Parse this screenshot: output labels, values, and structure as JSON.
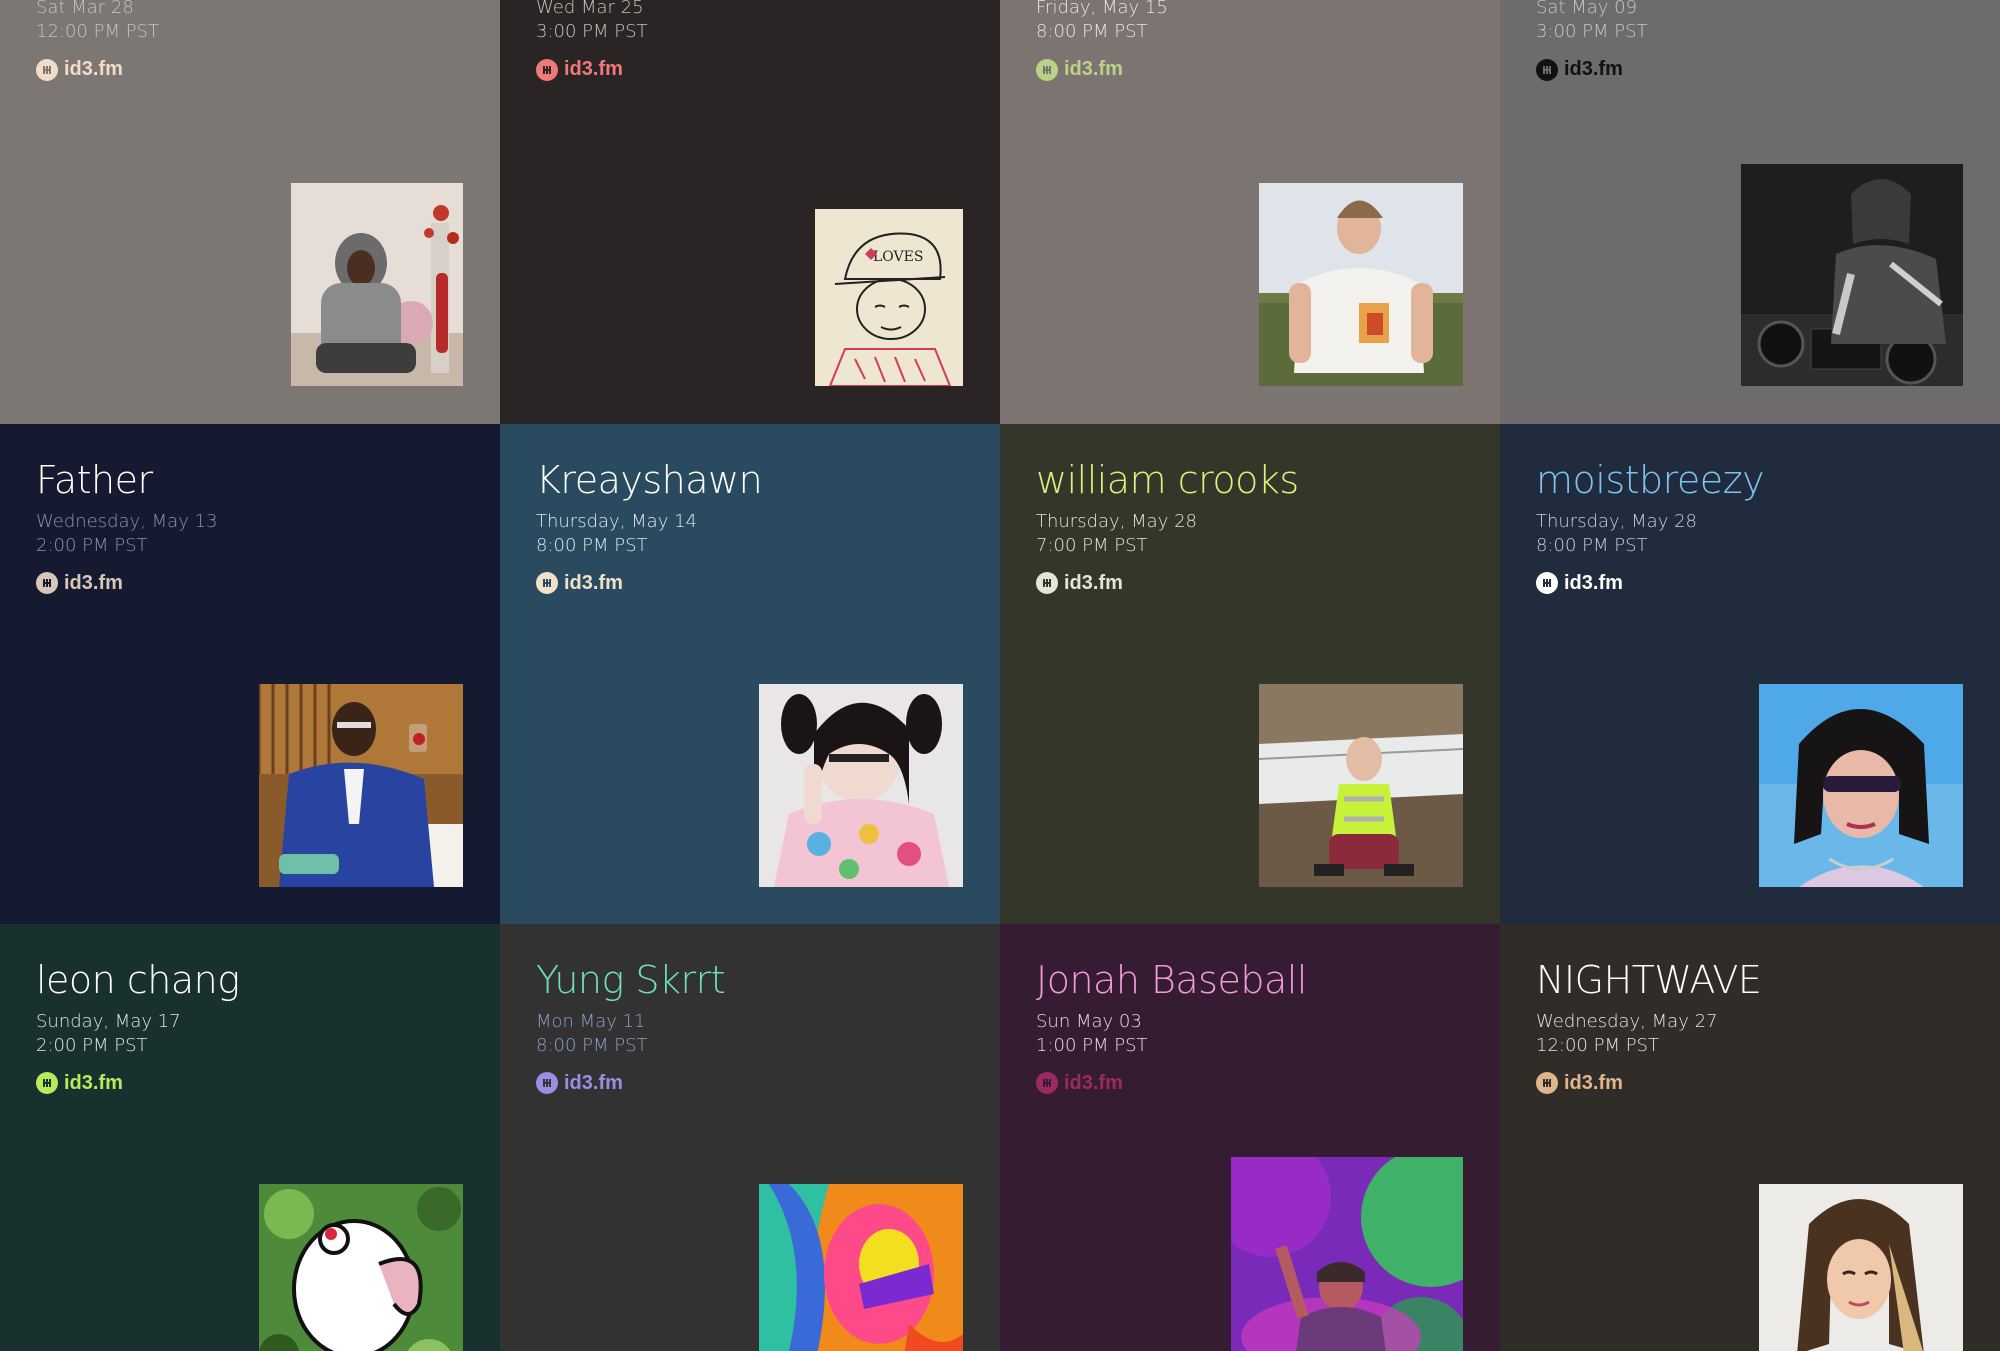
{
  "brand_label": "id3.fm",
  "shows": [
    {
      "name": "",
      "date": "Sat Mar 28",
      "time": "12:00 PM PST",
      "bg": "#7d7774",
      "name_color": "#ffffff",
      "meta_color": "#c9c3bf",
      "brand_color": "#f0dcc8",
      "icon_name": "id3-logo-icon"
    },
    {
      "name": "",
      "date": "Wed Mar 25",
      "time": "3:00 PM PST",
      "bg": "#2a2524",
      "name_color": "#ffffff",
      "meta_color": "#c9c3bf",
      "brand_color": "#f07a7a",
      "icon_name": "id3-logo-icon"
    },
    {
      "name": "",
      "date": "Friday, May 15",
      "time": "8:00 PM PST",
      "bg": "#7c7470",
      "name_color": "#ffffff",
      "meta_color": "#ece4de",
      "brand_color": "#b9d28a",
      "icon_name": "id3-logo-icon"
    },
    {
      "name": "",
      "date": "Sat May 09",
      "time": "3:00 PM PST",
      "bg": "#6e6c6a",
      "name_color": "#ffffff",
      "meta_color": "#c9c6c3",
      "brand_color": "#111111",
      "icon_name": "id3-logo-icon"
    },
    {
      "name": "Father",
      "date": "Wednesday, May 13",
      "time": "2:00 PM PST",
      "bg": "#151a31",
      "name_color": "#ffffff",
      "meta_color": "#8d90b6",
      "brand_color": "#d8c7b4",
      "icon_name": "id3-logo-icon"
    },
    {
      "name": "Kreayshawn",
      "date": "Thursday, May 14",
      "time": "8:00 PM PST",
      "bg": "#2a4b5f",
      "name_color": "#ffffff",
      "meta_color": "#dfe8ee",
      "brand_color": "#efe2c8",
      "icon_name": "id3-logo-icon"
    },
    {
      "name": "william crooks",
      "date": "Thursday, May 28",
      "time": "7:00 PM PST",
      "bg": "#35362a",
      "name_color": "#d9f27a",
      "meta_color": "#e6e4d6",
      "brand_color": "#e4e4d8",
      "icon_name": "id3-logo-icon"
    },
    {
      "name": "moistbreezy",
      "date": "Thursday, May 28",
      "time": "8:00 PM PST",
      "bg": "#202c3d",
      "name_color": "#7ec4f0",
      "meta_color": "#c5cfdb",
      "brand_color": "#ffffff",
      "icon_name": "id3-logo-icon"
    },
    {
      "name": "leon chang",
      "date": "Sunday, May 17",
      "time": "2:00 PM PST",
      "bg": "#18312f",
      "name_color": "#ffffff",
      "meta_color": "#e1e8e6",
      "brand_color": "#b6ec5c",
      "icon_name": "id3-logo-icon"
    },
    {
      "name": "Yung Skrrt",
      "date": "Mon May 11",
      "time": "8:00 PM PST",
      "bg": "#323232",
      "name_color": "#6ee0b9",
      "meta_color": "#8ea0c8",
      "brand_color": "#9a8ee0",
      "icon_name": "id3-logo-icon"
    },
    {
      "name": "Jonah Baseball",
      "date": "Sun May 03",
      "time": "1:00 PM PST",
      "bg": "#361c33",
      "name_color": "#f39ad8",
      "meta_color": "#e8dde6",
      "brand_color": "#9b2a60",
      "icon_name": "id3-logo-icon"
    },
    {
      "name": "NIGHTWAVE",
      "date": "Wednesday, May 27",
      "time": "12:00 PM PST",
      "bg": "#302d29",
      "name_color": "#ffffff",
      "meta_color": "#e8e4de",
      "brand_color": "#e0b58a",
      "icon_name": "id3-logo-icon"
    }
  ]
}
